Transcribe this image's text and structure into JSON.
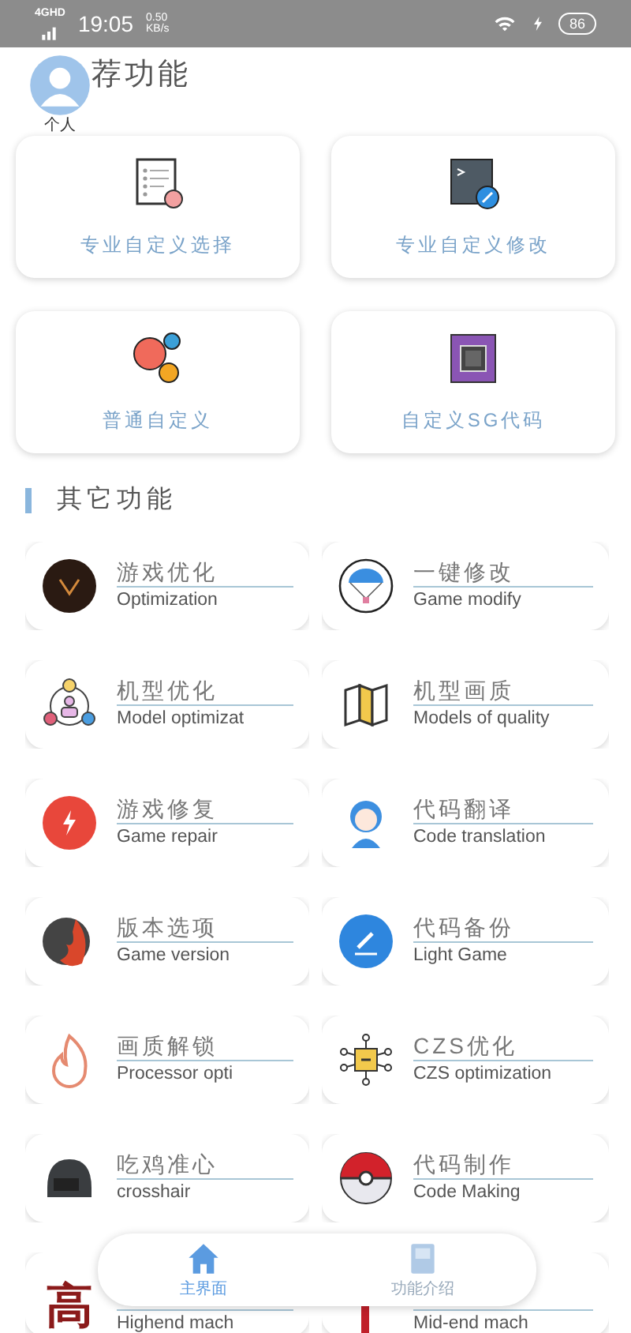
{
  "status_bar": {
    "network": "4GHD",
    "time": "19:05",
    "speed": "0.50",
    "speed_unit": "KB/s",
    "battery": "86"
  },
  "profile": {
    "label": "个人"
  },
  "featured": {
    "title": "荐功能",
    "items": [
      {
        "label": "专业自定义选择"
      },
      {
        "label": "专业自定义修改"
      },
      {
        "label": "普通自定义"
      },
      {
        "label": "自定义SG代码"
      }
    ]
  },
  "other": {
    "title": "其它功能",
    "items": [
      {
        "title": "游戏优化",
        "subtitle": "Optimization"
      },
      {
        "title": "一键修改",
        "subtitle": "Game modify"
      },
      {
        "title": "机型优化",
        "subtitle": "Model optimizat"
      },
      {
        "title": "机型画质",
        "subtitle": "Models of quality"
      },
      {
        "title": "游戏修复",
        "subtitle": "Game repair"
      },
      {
        "title": "代码翻译",
        "subtitle": "Code translation"
      },
      {
        "title": "版本选项",
        "subtitle": "Game version"
      },
      {
        "title": "代码备份",
        "subtitle": "Light Game"
      },
      {
        "title": "画质解锁",
        "subtitle": "Processor opti"
      },
      {
        "title": "CZS优化",
        "subtitle": "CZS optimization"
      },
      {
        "title": "吃鸡准心",
        "subtitle": "crosshair"
      },
      {
        "title": "代码制作",
        "subtitle": "Code Making"
      },
      {
        "glyph": "高",
        "subtitle": "Highend mach"
      },
      {
        "subtitle": "Mid-end mach"
      }
    ]
  },
  "bottom_nav": [
    {
      "label": "主界面",
      "selected": true
    },
    {
      "label": "功能介绍",
      "selected": false
    }
  ]
}
